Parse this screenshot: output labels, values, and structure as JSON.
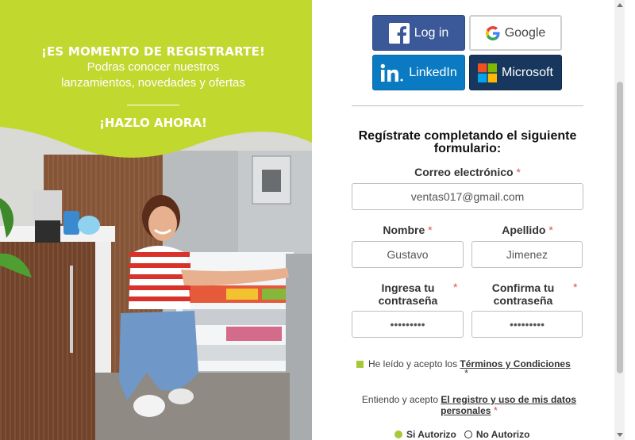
{
  "promo": {
    "title": "¡ES MOMENTO DE REGISTRARTE!",
    "subtitle_line1": "Podras conocer nuestros",
    "subtitle_line2": "lanzamientos, novedades y ofertas",
    "cta": "¡HAZLO AHORA!",
    "accent_color": "#c1d82f"
  },
  "social": {
    "facebook": {
      "label": "Log in",
      "icon": "facebook-icon",
      "color": "#3b5998"
    },
    "google": {
      "label": "Google",
      "icon": "google-icon"
    },
    "linkedin": {
      "label": "LinkedIn",
      "icon": "linkedin-icon",
      "color": "#0a7bc2"
    },
    "microsoft": {
      "label": "Microsoft",
      "icon": "microsoft-icon",
      "color": "#17375e"
    }
  },
  "form": {
    "heading": "Regístrate completando el siguiente formulario:",
    "required_mark": "*",
    "email": {
      "label": "Correo electrónico",
      "value": "ventas017@gmail.com"
    },
    "first_name": {
      "label": "Nombre",
      "value": "Gustavo"
    },
    "last_name": {
      "label": "Apellido",
      "value": "Jimenez"
    },
    "password": {
      "label": "Ingresa tu contraseña",
      "value": "•••••••••"
    },
    "confirm_password": {
      "label": "Confirma tu contraseña",
      "value": "•••••••••"
    },
    "terms": {
      "prefix": "He leído y acepto los",
      "link": "Términos y Condiciones"
    },
    "data_use": {
      "prefix": "Entiendo y acepto",
      "link": "El registro y uso de mis datos personales"
    },
    "authorize_yes": "Si Autorizo",
    "authorize_no": "No Autorizo"
  }
}
